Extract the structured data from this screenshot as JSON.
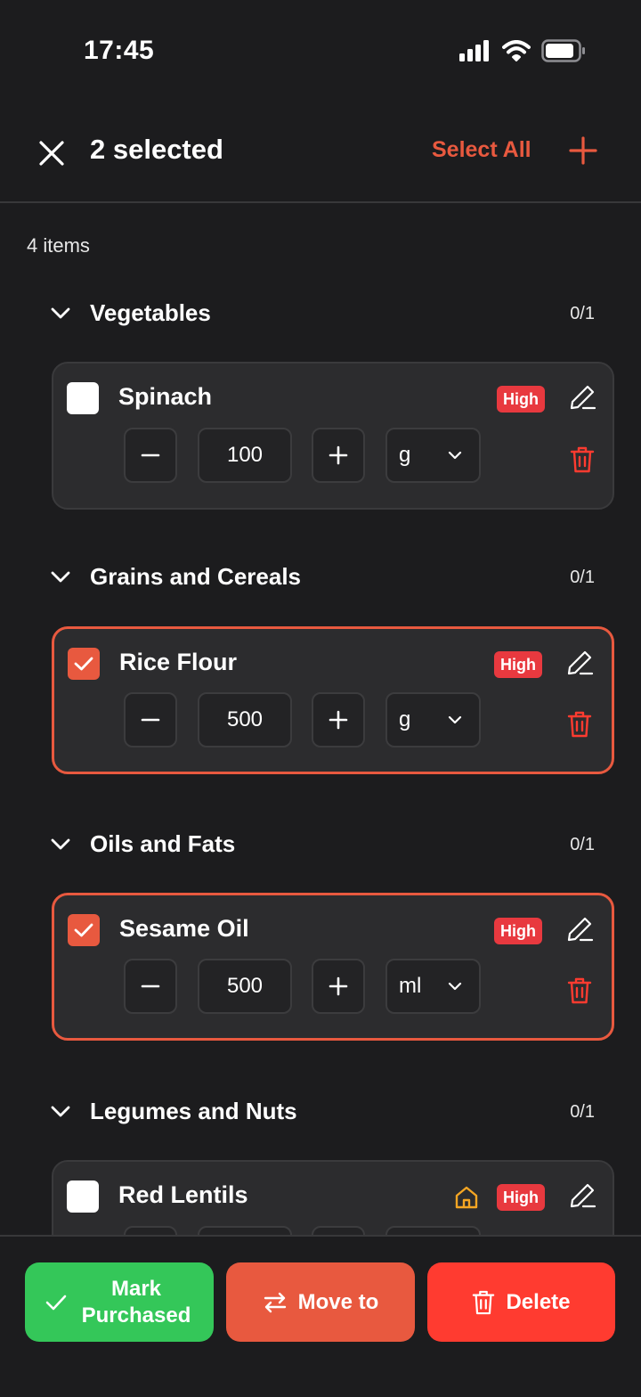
{
  "status_bar": {
    "time": "17:45"
  },
  "header": {
    "title": "2 selected",
    "select_all_label": "Select All"
  },
  "list": {
    "items_count": "4 items"
  },
  "sections": [
    {
      "title": "Vegetables",
      "count": "0/1",
      "item": {
        "name": "Spinach",
        "priority": "High",
        "quantity": "100",
        "unit": "g",
        "checked": false
      }
    },
    {
      "title": "Grains and Cereals",
      "count": "0/1",
      "item": {
        "name": "Rice Flour",
        "priority": "High",
        "quantity": "500",
        "unit": "g",
        "checked": true
      }
    },
    {
      "title": "Oils and Fats",
      "count": "0/1",
      "item": {
        "name": "Sesame Oil",
        "priority": "High",
        "quantity": "500",
        "unit": "ml",
        "checked": true
      }
    },
    {
      "title": "Legumes and Nuts",
      "count": "0/1",
      "item": {
        "name": "Red Lentils",
        "priority": "High",
        "checked": false,
        "has_pantry_icon": true
      }
    }
  ],
  "actions": {
    "mark_purchased_line1": "Mark",
    "mark_purchased_line2": "Purchased",
    "move_to": "Move to",
    "delete": "Delete"
  },
  "colors": {
    "background": "#1c1c1e",
    "card": "#2c2c2e",
    "accent": "#e8593f",
    "priority_badge": "#e8393f",
    "success": "#34c759",
    "danger": "#ff3b30",
    "pantry_icon": "#f5a623"
  },
  "icons": [
    "close-icon",
    "plus-icon",
    "chevron-down-icon",
    "checkmark-icon",
    "pencil-icon",
    "trash-icon",
    "minus-icon",
    "home-icon",
    "swap-arrows-icon",
    "signal-icon",
    "wifi-icon",
    "battery-icon"
  ]
}
